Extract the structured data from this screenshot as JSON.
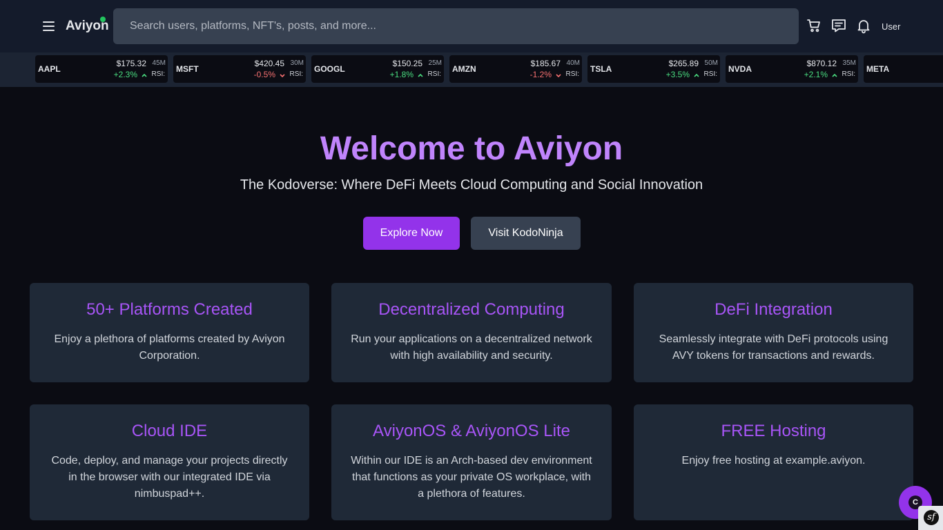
{
  "header": {
    "logo": "Aviyon",
    "search_placeholder": "Search users, platforms, NFT's, posts, and more...",
    "avatar_alt": "User"
  },
  "ticker": [
    {
      "symbol": "AAPL",
      "price": "$175.32",
      "volume": "45M",
      "change": "+2.3%",
      "direction": "up",
      "rsi": "RSI:"
    },
    {
      "symbol": "MSFT",
      "price": "$420.45",
      "volume": "30M",
      "change": "-0.5%",
      "direction": "down",
      "rsi": "RSI:"
    },
    {
      "symbol": "GOOGL",
      "price": "$150.25",
      "volume": "25M",
      "change": "+1.8%",
      "direction": "up",
      "rsi": "RSI:"
    },
    {
      "symbol": "AMZN",
      "price": "$185.67",
      "volume": "40M",
      "change": "-1.2%",
      "direction": "down",
      "rsi": "RSI:"
    },
    {
      "symbol": "TSLA",
      "price": "$265.89",
      "volume": "50M",
      "change": "+3.5%",
      "direction": "up",
      "rsi": "RSI:"
    },
    {
      "symbol": "NVDA",
      "price": "$870.12",
      "volume": "35M",
      "change": "+2.1%",
      "direction": "up",
      "rsi": "RSI:"
    },
    {
      "symbol": "META",
      "price": "",
      "volume": "",
      "change": "",
      "direction": "",
      "rsi": ""
    }
  ],
  "hero": {
    "title": "Welcome to Aviyon",
    "subtitle": "The Kodoverse: Where DeFi Meets Cloud Computing and Social Innovation",
    "primary_button": "Explore Now",
    "secondary_button": "Visit KodoNinja"
  },
  "features": [
    {
      "title": "50+ Platforms Created",
      "description": "Enjoy a plethora of platforms created by Aviyon Corporation."
    },
    {
      "title": "Decentralized Computing",
      "description": "Run your applications on a decentralized network with high availability and security."
    },
    {
      "title": "DeFi Integration",
      "description": "Seamlessly integrate with DeFi protocols using AVY tokens for transactions and rewards."
    },
    {
      "title": "Cloud IDE",
      "description": "Code, deploy, and manage your projects directly in the browser with our integrated IDE via nimbuspad++."
    },
    {
      "title": "AviyonOS & AviyonOS Lite",
      "description": "Within our IDE is an Arch-based dev environment that functions as your private OS workplace, with a plethora of features."
    },
    {
      "title": "FREE Hosting",
      "description": "Enjoy free hosting at example.aviyon."
    }
  ],
  "floating": {
    "chat_glyph": "C",
    "corner_glyph": "sf"
  },
  "colors": {
    "accent": "#9333ea",
    "title": "#c084fc",
    "up": "#4ade80",
    "down": "#f87171",
    "status_online": "#22c55e"
  },
  "icons": [
    "menu-icon",
    "cart-icon",
    "message-icon",
    "bell-icon",
    "chevron-up-icon",
    "chevron-down-icon"
  ]
}
